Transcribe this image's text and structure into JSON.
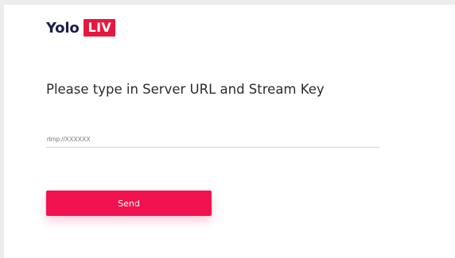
{
  "logo": {
    "word": "Yolo",
    "badge": "LIV",
    "badge_color": "#e8173f",
    "word_color": "#1a1f4a"
  },
  "form": {
    "heading": "Please type in Server URL and Stream Key",
    "url_input": {
      "value": "",
      "placeholder": "rtmp://XXXXXX"
    },
    "send_label": "Send",
    "accent_color": "#f2124f"
  }
}
